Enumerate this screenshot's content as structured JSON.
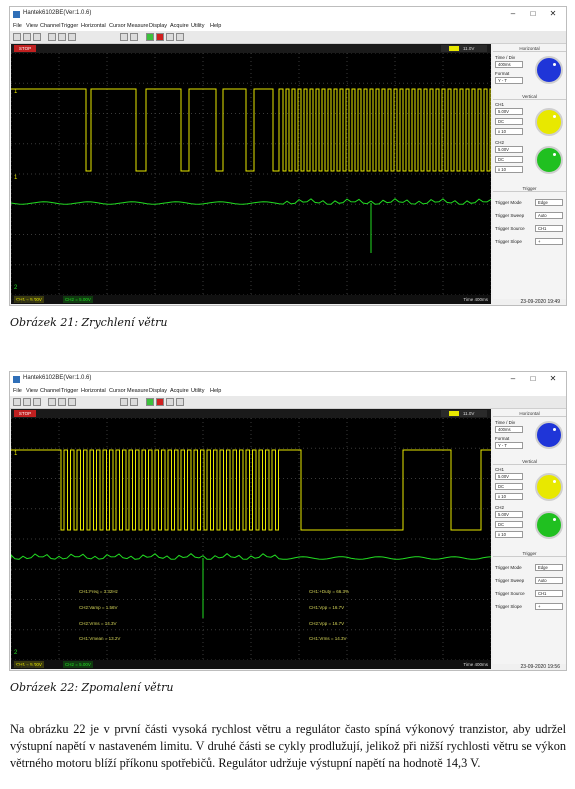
{
  "figures": [
    {
      "window_title": "Hantek6102BE(Ver:1.0.6)",
      "menu": [
        "File",
        "View",
        "Channel",
        "Trigger",
        "Horizontal",
        "Cursor",
        "Measure",
        "Display",
        "Acquire",
        "Utility",
        "Help"
      ],
      "run_state": "STOP",
      "trigger_value": "11.0V",
      "status": {
        "ch1": "CH1 = 5.00V",
        "ch2": "CH2 = 5.00V",
        "time": "Time 400ms"
      },
      "connection": "Connected",
      "datetime": "23-09-2020 19:49",
      "caption": "Obrázek 21: Zrychlení větru",
      "measurements": []
    },
    {
      "window_title": "Hantek6102BE(Ver:1.0.6)",
      "menu": [
        "File",
        "View",
        "Channel",
        "Trigger",
        "Horizontal",
        "Cursor",
        "Measure",
        "Display",
        "Acquire",
        "Utility",
        "Help"
      ],
      "run_state": "STOP",
      "trigger_value": "11.0V",
      "status": {
        "ch1": "CH1 = 5.00V",
        "ch2": "CH2 = 5.00V",
        "time": "Time 400ms"
      },
      "connection": "Connected",
      "datetime": "23-09-2020 19:56",
      "caption": "Obrázek 22: Zpomalení větru",
      "measurements": [
        "CH1:Freq = 3.32Hz",
        "CH2:Vamp = 1.56V",
        "CH2:Vrms = 14.3V",
        "CH1:Vmean = 13.2V",
        "CH1:+Duty = 66.3%",
        "CH1:Vpp = 16.7V",
        "CH2:Vpp = 16.7V",
        "CH1:Vrms = 14.3V"
      ]
    }
  ],
  "panel": {
    "horizontal_title": "Horizontal",
    "time_div_label": "Time / Div",
    "time_div_value": "400ms",
    "format_label": "Format",
    "format_value": "Y - T",
    "vertical_title": "Vertical",
    "ch1_label": "CH1",
    "ch1_volt": "5.00V",
    "ch1_coupling": "DC",
    "ch1_probe": "x 10",
    "ch2_label": "CH2",
    "ch2_volt": "5.00V",
    "ch2_coupling": "DC",
    "ch2_probe": "x 10",
    "trigger_title": "Trigger",
    "trig_mode_label": "Trigger Mode",
    "trig_mode_value": "Edge",
    "trig_sweep_label": "Trigger Sweep",
    "trig_sweep_value": "Auto",
    "trig_source_label": "Trigger Source",
    "trig_source_value": "CH1",
    "trig_slope_label": "Trigger Slope",
    "trig_slope_value": "+"
  },
  "colors": {
    "ch1": "#e8e800",
    "ch2": "#22dd22",
    "knob_h": "#1f35d8",
    "knob_v1": "#e8e800",
    "knob_v2": "#20c020"
  },
  "paragraph": "Na obrázku 22 je v první části vysoká rychlost větru a regulátor často spíná výkonový tranzistor, aby udržel výstupní napětí v nastaveném limitu. V druhé části se cykly prodlužují, jelikož při nižší rychlosti větru se výkon větrného motoru blíží příkonu spotřebičů. Regulátor udržuje výstupní napětí na hodnotě 14,3 V."
}
